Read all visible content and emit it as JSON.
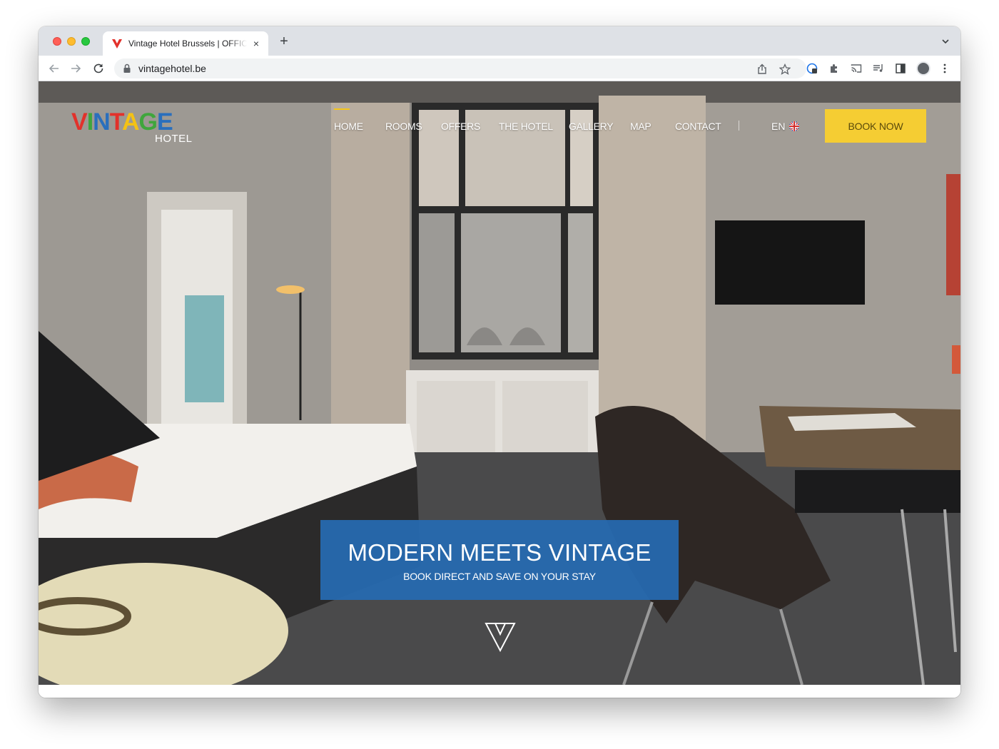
{
  "browser": {
    "tab_title": "Vintage Hotel Brussels | OFFICIAL SITE",
    "url": "vintagehotel.be",
    "new_tab_label": "+",
    "close_tab_label": "×"
  },
  "site": {
    "logo_word": "VINTAGE",
    "logo_sub": "HOTEL",
    "nav": [
      "HOME",
      "ROOMS",
      "OFFERS",
      "THE HOTEL",
      "GALLERY",
      "MAP",
      "CONTACT"
    ],
    "active_nav": "HOME",
    "language": "EN",
    "book_label": "BOOK NOW"
  },
  "hero": {
    "title": "MODERN MEETS VINTAGE",
    "subtitle": "BOOK DIRECT AND SAVE ON YOUR STAY"
  },
  "colors": {
    "accent_yellow": "#f5cd33",
    "hero_blue": "#266bb2",
    "logo_red": "#e2312b",
    "logo_yellow": "#f4c215",
    "logo_green": "#3fa63c",
    "logo_blue": "#2a6fbd"
  },
  "icons": [
    "back-arrow-icon",
    "forward-arrow-icon",
    "reload-icon",
    "lock-icon",
    "share-icon",
    "star-icon",
    "extension-icon",
    "puzzle-icon",
    "cast-icon",
    "media-icon",
    "sidebar-icon",
    "kebab-menu-icon",
    "uk-flag-icon",
    "scroll-down-icon"
  ]
}
